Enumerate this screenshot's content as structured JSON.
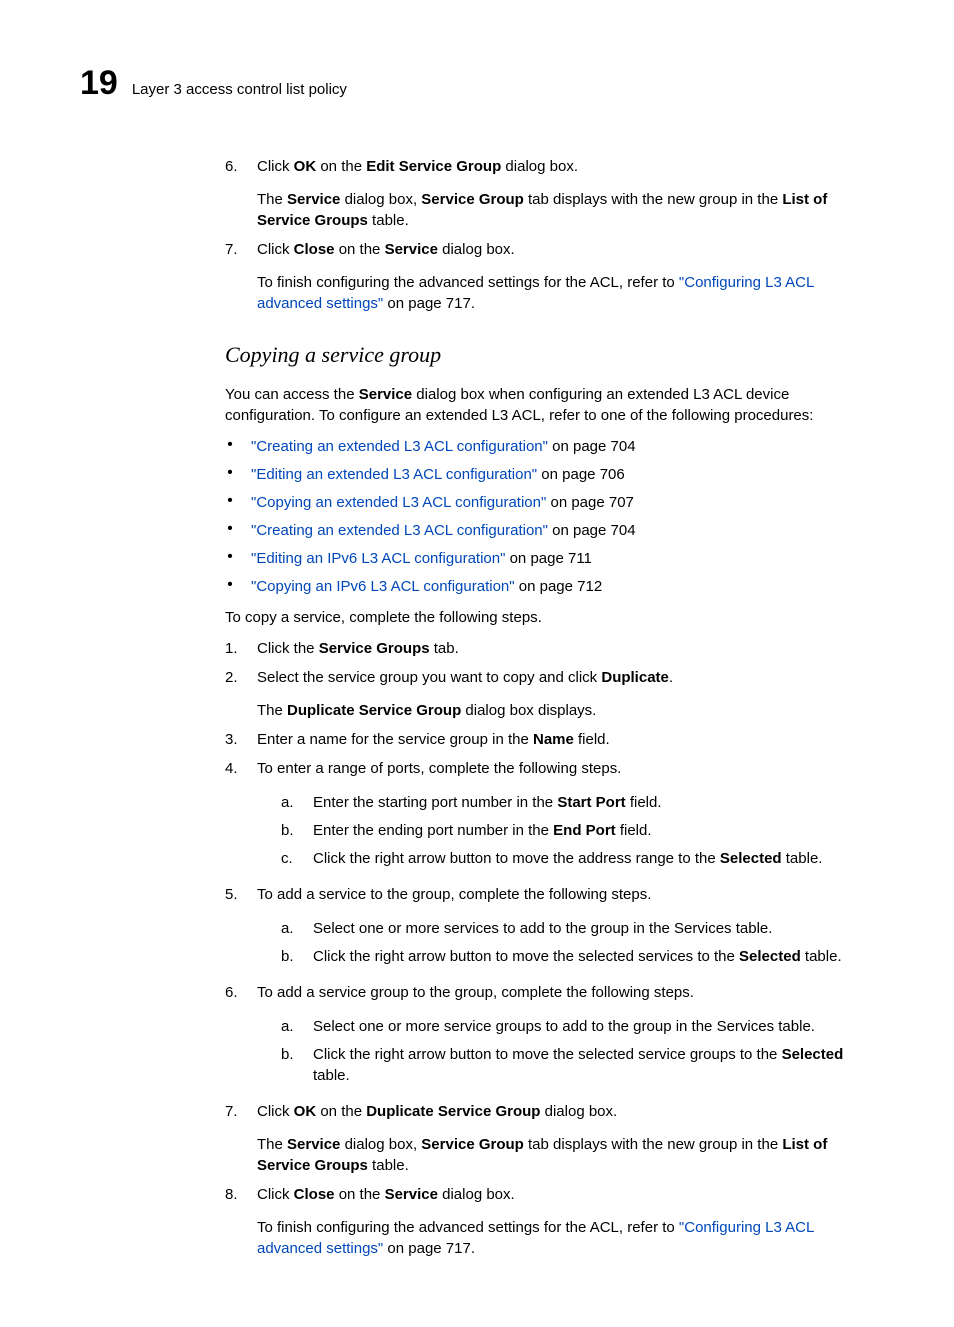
{
  "header": {
    "chapter_number": "19",
    "title": "Layer 3 access control list policy"
  },
  "top_steps": [
    {
      "num": "6.",
      "html": "Click <b>OK</b> on the <b>Edit Service Group</b> dialog box.",
      "after_html": "The <b>Service</b> dialog box, <b>Service Group</b> tab displays with the new group in the <b>List of Service Groups</b> table."
    },
    {
      "num": "7.",
      "html": "Click <b>Close</b> on the <b>Service</b> dialog box.",
      "after_mixed": {
        "prefix": "To finish configuring the advanced settings for the ACL, refer to ",
        "link": "\"Configuring L3 ACL advanced settings\"",
        "suffix": " on page 717."
      }
    }
  ],
  "section_heading": "Copying a service group",
  "intro_html": "You can access the <b>Service</b> dialog box when configuring an extended L3 ACL device configuration. To configure an extended L3 ACL, refer to one of the following procedures:",
  "bullets": [
    {
      "link": "\"Creating an extended L3 ACL configuration\"",
      "suffix": " on page 704"
    },
    {
      "link": "\"Editing an extended L3 ACL configuration\"",
      "suffix": " on page 706"
    },
    {
      "link": "\"Copying an extended L3 ACL configuration\"",
      "suffix": " on page 707"
    },
    {
      "link": "\"Creating an extended L3 ACL configuration\"",
      "suffix": " on page 704"
    },
    {
      "link": "\"Editing an IPv6 L3 ACL configuration\"",
      "suffix": " on page 711"
    },
    {
      "link": "\"Copying an IPv6 L3 ACL configuration\"",
      "suffix": " on page 712"
    }
  ],
  "post_bullets_para": "To copy a service, complete the following steps.",
  "bottom_steps": [
    {
      "num": "1.",
      "html": "Click the <b>Service Groups</b> tab."
    },
    {
      "num": "2.",
      "html": "Select the service group you want to copy and click <b>Duplicate</b>.",
      "after_html": "The <b>Duplicate Service Group</b> dialog box displays."
    },
    {
      "num": "3.",
      "html": "Enter a name for the service group in the <b>Name</b> field."
    },
    {
      "num": "4.",
      "html": "To enter a range of ports, complete the following steps.",
      "subs": [
        {
          "letter": "a.",
          "html": "Enter the starting port number in the <b>Start Port</b> field."
        },
        {
          "letter": "b.",
          "html": "Enter the ending port number in the <b>End Port</b> field."
        },
        {
          "letter": "c.",
          "html": "Click the right arrow button to move the address range to the <b>Selected</b> table."
        }
      ]
    },
    {
      "num": "5.",
      "html": "To add a service to the group, complete the following steps.",
      "subs": [
        {
          "letter": "a.",
          "html": "Select one or more services to add to the group in the Services table."
        },
        {
          "letter": "b.",
          "html": "Click the right arrow button to move the selected services to the <b>Selected</b> table."
        }
      ]
    },
    {
      "num": "6.",
      "html": "To add a service group to the group, complete the following steps.",
      "subs": [
        {
          "letter": "a.",
          "html": "Select one or more service groups to add to the group in the Services table."
        },
        {
          "letter": "b.",
          "html": "Click the right arrow button to move the selected service groups to the <b>Selected</b> table."
        }
      ]
    },
    {
      "num": "7.",
      "html": "Click <b>OK</b> on the <b>Duplicate Service Group</b> dialog box.",
      "after_html": "The <b>Service</b> dialog box, <b>Service Group</b> tab displays with the new group in the <b>List of Service Groups</b> table."
    },
    {
      "num": "8.",
      "html": "Click <b>Close</b> on the <b>Service</b> dialog box.",
      "after_mixed": {
        "prefix": "To finish configuring the advanced settings for the ACL, refer to ",
        "link": "\"Configuring L3 ACL advanced settings\"",
        "suffix": " on page 717."
      }
    }
  ]
}
